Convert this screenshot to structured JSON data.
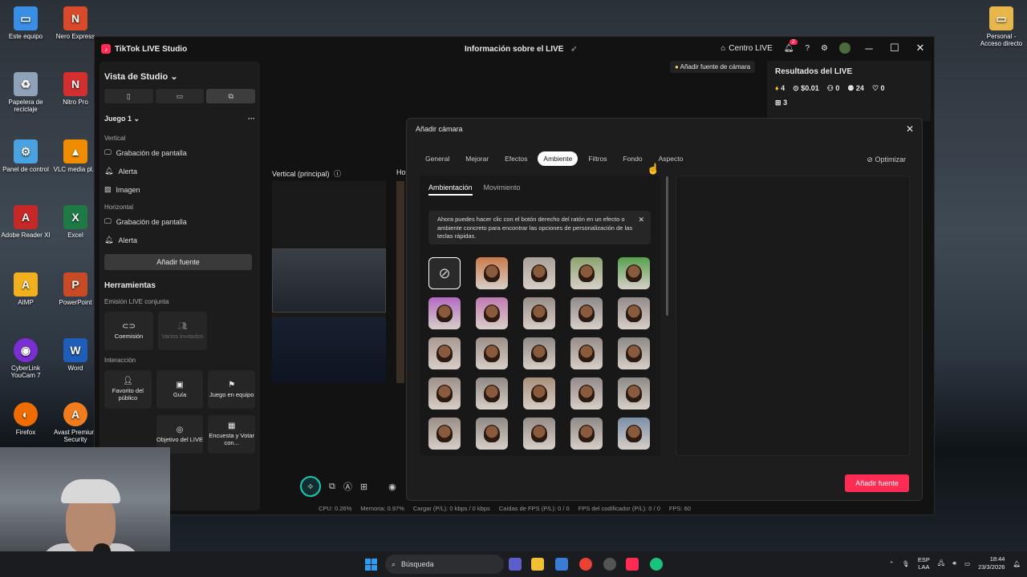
{
  "desktop": {
    "icons": [
      {
        "label": "Este equipo",
        "color": "#3a8ee6",
        "glyph": "▭"
      },
      {
        "label": "Nero Express",
        "color": "#d84a2a",
        "glyph": "N"
      },
      {
        "label": "Papelera de reciclaje",
        "color": "#c9d7e6",
        "glyph": "♻"
      },
      {
        "label": "Nitro Pro",
        "color": "#d32f2f",
        "glyph": "N"
      },
      {
        "label": "Panel de control",
        "color": "#4aa3df",
        "glyph": "⚙"
      },
      {
        "label": "VLC media pl...",
        "color": "#f08c00",
        "glyph": "▲"
      },
      {
        "label": "Adobe Reader XI",
        "color": "#c62828",
        "glyph": "A"
      },
      {
        "label": "Excel",
        "color": "#1e7a45",
        "glyph": "X"
      },
      {
        "label": "AIMP",
        "color": "#f2b01e",
        "glyph": "A"
      },
      {
        "label": "PowerPoint",
        "color": "#c84b25",
        "glyph": "P"
      },
      {
        "label": "CyberLink YouCam 7",
        "color": "#7a2fd3",
        "glyph": "◉"
      },
      {
        "label": "Word",
        "color": "#1f5eb8",
        "glyph": "W"
      },
      {
        "label": "Firefox",
        "color": "#ef6c00",
        "glyph": "◐"
      },
      {
        "label": "Avast Premium Security",
        "color": "#f07c1e",
        "glyph": "A"
      },
      {
        "label": "Personal - Acceso directo",
        "color": "#e8b64a",
        "glyph": "▭"
      }
    ]
  },
  "app": {
    "name": "TikTok LIVE Studio",
    "center_title": "Información sobre el LIVE",
    "centro_live": "Centro LIVE",
    "notif_count": "2",
    "add_camera_hint": "Añadir fuente de cámara"
  },
  "left_panel": {
    "view_label": "Vista de Studio",
    "scene_name": "Juego 1",
    "vertical_label": "Vertical",
    "vertical_sources": [
      "Grabación de pantalla",
      "Alerta",
      "Imagen"
    ],
    "horizontal_label": "Horizontal",
    "horizontal_sources": [
      "Grabación de pantalla",
      "Alerta"
    ],
    "add_source": "Añadir fuente",
    "tools_label": "Herramientas",
    "joint_label": "Emisión LIVE conjunta",
    "joint_tools": [
      {
        "label": "Coemisión",
        "glyph": "⊂⊃",
        "dim": false
      },
      {
        "label": "Varios invitados",
        "glyph": "👥",
        "dim": true
      }
    ],
    "interaction_label": "Interacción",
    "interaction_tools": [
      {
        "label": "Favorito del público",
        "glyph": "👤"
      },
      {
        "label": "Guía",
        "glyph": "▣"
      },
      {
        "label": "Juego en equipo",
        "glyph": "⚑"
      }
    ],
    "interaction_tools_2": [
      {
        "label": "Objetivo del LIVE",
        "glyph": "◎"
      },
      {
        "label": "Encuesta y Votar con...",
        "glyph": "▦"
      }
    ]
  },
  "preview": {
    "vertical_label": "Vertical (principal)",
    "horizontal_label": "Ho"
  },
  "results": {
    "title": "Resultados del LIVE",
    "stats": [
      "4",
      "$0.01",
      "0",
      "24",
      "0"
    ],
    "gift_count": "3"
  },
  "status_bar": [
    "CPU: 0.26%",
    "Memoria: 0.97%",
    "Cargar (P/L): 0 kbps / 0 kbps",
    "Caídas de FPS (P/L): 0 / 0",
    "FPS del codificador (P/L): 0 / 0",
    "FPS: 60"
  ],
  "modal": {
    "title": "Añadir cámara",
    "tabs": [
      "General",
      "Mejorar",
      "Efectos",
      "Ambiente",
      "Filtros",
      "Fondo",
      "Aspecto"
    ],
    "active_tab": "Ambiente",
    "optimize": "Optimizar",
    "subtabs": [
      "Ambientación",
      "Movimiento"
    ],
    "notice": "Ahora puedes hacer clic con el botón derecho del ratón en un efecto o ambiente concreto para encontrar las opciones de personalización de las teclas rápidas.",
    "add_button": "Añadir fuente"
  },
  "taskbar": {
    "search": "Búsqueda",
    "lang_top": "ESP",
    "lang_bottom": "LAA",
    "time": "18:44",
    "date": "23/3/2026"
  }
}
